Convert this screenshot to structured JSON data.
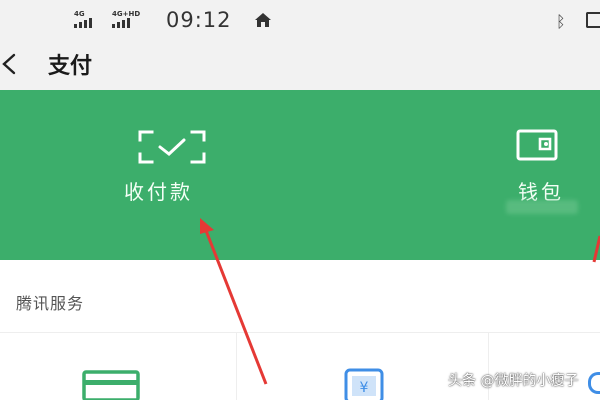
{
  "status_bar": {
    "network_1": "4G",
    "network_2": "4G+HD",
    "time": "09:12"
  },
  "header": {
    "title": "支付"
  },
  "green_panel": {
    "pay_label": "收付款",
    "wallet_label": "钱包"
  },
  "services": {
    "section_title": "腾讯服务"
  },
  "watermark": "头条 @微胖的小瘦子",
  "colors": {
    "brand_green": "#3cae6b",
    "annotation_red": "#e53935",
    "header_bg": "#f2f2f2"
  },
  "icons": {
    "back": "back-chevron-icon",
    "scan": "scan-frame-icon",
    "wallet": "wallet-icon",
    "card": "card-icon",
    "phone_yuan": "phone-yuan-icon"
  }
}
